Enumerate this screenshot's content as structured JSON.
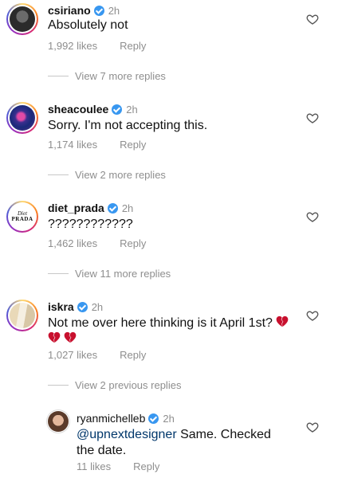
{
  "comments": [
    {
      "username": "csiriano",
      "time": "2h",
      "text": "Absolutely not",
      "likes": "1,992 likes",
      "reply": "Reply",
      "view_replies": "View 7 more replies"
    },
    {
      "username": "sheacoulee",
      "time": "2h",
      "text": "Sorry. I'm not accepting this.",
      "likes": "1,174 likes",
      "reply": "Reply",
      "view_replies": "View 2 more replies"
    },
    {
      "username": "diet_prada",
      "time": "2h",
      "text": "????????????",
      "likes": "1,462 likes",
      "reply": "Reply",
      "view_replies": "View 11 more replies",
      "avatar_text_1": "Diet",
      "avatar_text_2": "PRADA"
    },
    {
      "username": "iskra",
      "time": "2h",
      "text": "Not me over here thinking is it April 1st?",
      "likes": "1,027 likes",
      "reply": "Reply",
      "view_replies": "View 2 previous replies"
    }
  ],
  "reply_comment": {
    "username": "ryanmichelleb",
    "time": "2h",
    "mention": "@upnextdesigner",
    "text": " Same. Checked the date.",
    "likes": "11 likes",
    "reply": "Reply"
  },
  "colors": {
    "verified": "#3897f0",
    "mention": "#00376b",
    "meta": "#8e8e8e",
    "broken_heart": "#c8102e"
  },
  "icons": {
    "like": "heart-outline-icon",
    "verified": "verified-badge-icon",
    "emoji": "broken-heart-emoji"
  }
}
